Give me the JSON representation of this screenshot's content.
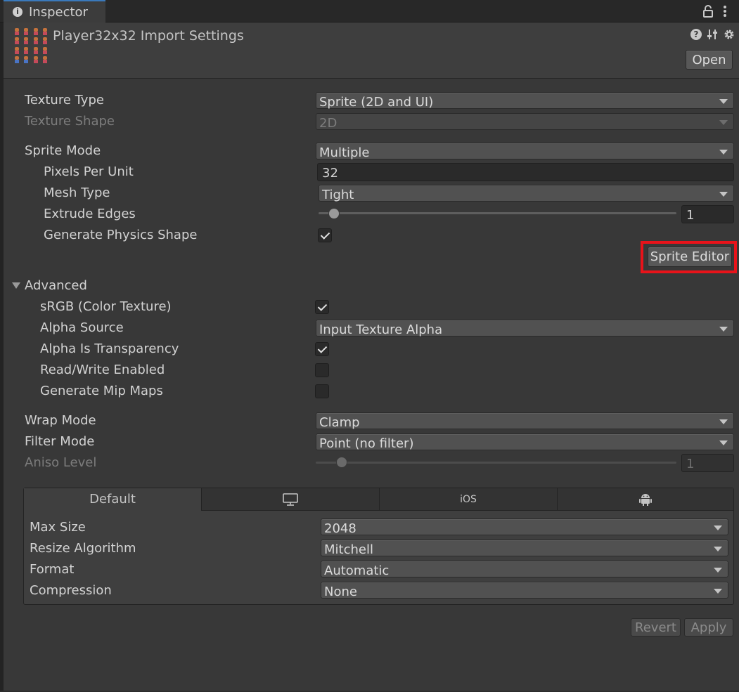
{
  "tab": {
    "title": "Inspector",
    "info_icon": "info-icon",
    "lock_icon": "lock-icon",
    "menu_icon": "kebab-menu-icon"
  },
  "header": {
    "title": "Player32x32 Import Settings",
    "open_label": "Open",
    "help_icon": "help-icon",
    "preset_icon": "presets-icon",
    "settings_icon": "gear-icon"
  },
  "fields": {
    "texture_type": {
      "label": "Texture Type",
      "value": "Sprite (2D and UI)"
    },
    "texture_shape": {
      "label": "Texture Shape",
      "value": "2D"
    },
    "sprite_mode": {
      "label": "Sprite Mode",
      "value": "Multiple"
    },
    "pixels_per_unit": {
      "label": "Pixels Per Unit",
      "value": "32"
    },
    "mesh_type": {
      "label": "Mesh Type",
      "value": "Tight"
    },
    "extrude_edges": {
      "label": "Extrude Edges",
      "value": "1",
      "fraction": 0.04
    },
    "generate_physics_shape": {
      "label": "Generate Physics Shape",
      "checked": true
    },
    "sprite_editor_label": "Sprite Editor"
  },
  "advanced": {
    "label": "Advanced",
    "srgb": {
      "label": "sRGB (Color Texture)",
      "checked": true
    },
    "alpha_source": {
      "label": "Alpha Source",
      "value": "Input Texture Alpha"
    },
    "alpha_is_transparency": {
      "label": "Alpha Is Transparency",
      "checked": true
    },
    "read_write": {
      "label": "Read/Write Enabled",
      "checked": false
    },
    "mip_maps": {
      "label": "Generate Mip Maps",
      "checked": false
    }
  },
  "sampling": {
    "wrap_mode": {
      "label": "Wrap Mode",
      "value": "Clamp"
    },
    "filter_mode": {
      "label": "Filter Mode",
      "value": "Point (no filter)"
    },
    "aniso_level": {
      "label": "Aniso Level",
      "value": "1",
      "fraction": 0.07
    }
  },
  "platform": {
    "tabs": [
      {
        "label": "Default",
        "icon": ""
      },
      {
        "label": "",
        "icon": "monitor-icon"
      },
      {
        "label": "iOS",
        "icon": ""
      },
      {
        "label": "",
        "icon": "android-icon"
      }
    ],
    "max_size": {
      "label": "Max Size",
      "value": "2048"
    },
    "resize_algorithm": {
      "label": "Resize Algorithm",
      "value": "Mitchell"
    },
    "format": {
      "label": "Format",
      "value": "Automatic"
    },
    "compression": {
      "label": "Compression",
      "value": "None"
    }
  },
  "footer": {
    "revert_label": "Revert",
    "apply_label": "Apply"
  },
  "colors": {
    "accent": "#3a79bb",
    "highlight": "#e8131a",
    "background": "#383838"
  }
}
